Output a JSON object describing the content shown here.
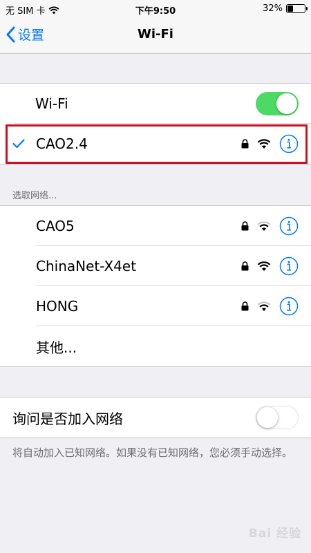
{
  "status_bar": {
    "carrier": "无 SIM 卡",
    "time": "下午9:50",
    "battery": "32%",
    "battery_level": 0.32
  },
  "nav": {
    "back_label": "设置",
    "title": "Wi-Fi"
  },
  "wifi_toggle": {
    "label": "Wi-Fi",
    "on": true
  },
  "connected_network": {
    "name": "CAO2.4",
    "secured": true,
    "signal": "full"
  },
  "networks_section": {
    "header": "选取网络...",
    "items": [
      {
        "name": "CAO5",
        "secured": true,
        "signal": "medium"
      },
      {
        "name": "ChinaNet-X4et",
        "secured": true,
        "signal": "full"
      },
      {
        "name": "HONG",
        "secured": true,
        "signal": "medium"
      }
    ],
    "other_label": "其他..."
  },
  "ask_to_join": {
    "label": "询问是否加入网络",
    "on": false,
    "note": "将自动加入已知网络。如果没有已知网络，您必须手动选择。"
  },
  "watermark": "Bai 经验",
  "colors": {
    "accent": "#007aff",
    "toggle_on": "#4cd964",
    "highlight": "#c8101f"
  }
}
